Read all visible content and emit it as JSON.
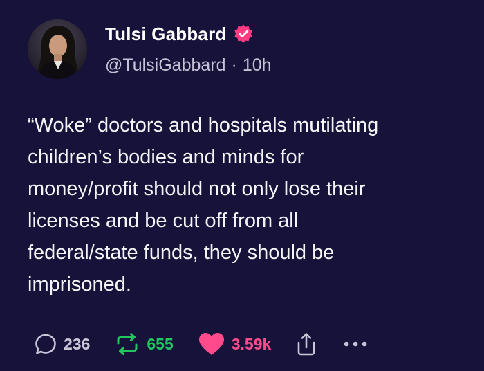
{
  "author": {
    "name": "Tulsi Gabbard",
    "handle": "@TulsiGabbard",
    "separator": "·",
    "time": "10h",
    "verified_icon": "verified-badge-icon"
  },
  "post": {
    "lines": [
      "“Woke” doctors and hospitals mutilating",
      "children’s bodies and minds for",
      "money/profit should not only lose their",
      "licenses and be cut off from all",
      "federal/state funds, they should be",
      "imprisoned."
    ]
  },
  "actions": {
    "replies": {
      "icon": "reply-icon",
      "count": "236"
    },
    "reposts": {
      "icon": "repost-icon",
      "count": "655"
    },
    "likes": {
      "icon": "heart-icon",
      "count": "3.59k"
    },
    "share": {
      "icon": "share-icon"
    },
    "more": {
      "icon": "more-icon"
    }
  },
  "colors": {
    "background": "#16123a",
    "text": "#f5f5f7",
    "muted": "#c7c3d6",
    "repost": "#22c55e",
    "like": "#ff4b8b",
    "verified": "#ff3c82"
  }
}
